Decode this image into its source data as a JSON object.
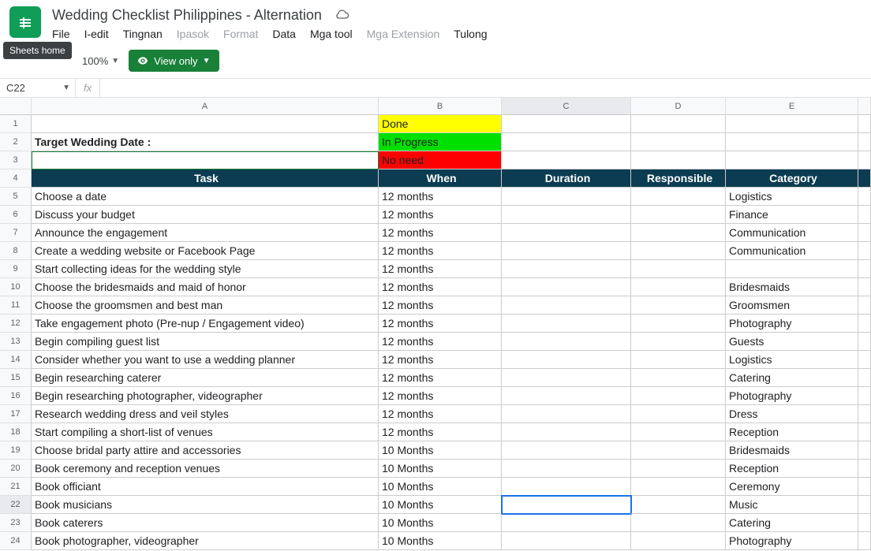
{
  "tooltip": "Sheets home",
  "doc_title": "Wedding Checklist Philippines - Alternation",
  "menus": {
    "file": "File",
    "edit": "I-edit",
    "view": "Tingnan",
    "insert": "Ipasok",
    "format": "Format",
    "data": "Data",
    "tools": "Mga tool",
    "extensions": "Mga Extension",
    "help": "Tulong"
  },
  "zoom": "100%",
  "view_only": "View only",
  "namebox": "C22",
  "cols": [
    "A",
    "B",
    "C",
    "D",
    "E"
  ],
  "status": {
    "done": "Done",
    "inprog": "In Progress",
    "noneed": "No need"
  },
  "target_label": "Target Wedding Date :",
  "headers": {
    "task": "Task",
    "when": "When",
    "duration": "Duration",
    "responsible": "Responsible",
    "category": "Category"
  },
  "rows": [
    {
      "n": 5,
      "task": "Choose a date",
      "when": "12 months",
      "cat": "Logistics"
    },
    {
      "n": 6,
      "task": "Discuss your budget",
      "when": "12 months",
      "cat": "Finance"
    },
    {
      "n": 7,
      "task": "Announce the engagement",
      "when": "12 months",
      "cat": "Communication"
    },
    {
      "n": 8,
      "task": "Create a wedding website or Facebook Page",
      "when": "12 months",
      "cat": "Communication"
    },
    {
      "n": 9,
      "task": "Start collecting ideas for the wedding style",
      "when": "12 months",
      "cat": ""
    },
    {
      "n": 10,
      "task": "Choose the bridesmaids and maid of honor",
      "when": "12 months",
      "cat": "Bridesmaids"
    },
    {
      "n": 11,
      "task": "Choose the groomsmen and best man",
      "when": "12 months",
      "cat": "Groomsmen"
    },
    {
      "n": 12,
      "task": "Take engagement photo (Pre-nup / Engagement video)",
      "when": "12 months",
      "cat": "Photography"
    },
    {
      "n": 13,
      "task": "Begin compiling guest list",
      "when": "12 months",
      "cat": "Guests"
    },
    {
      "n": 14,
      "task": "Consider whether you want to use a wedding planner",
      "when": "12 months",
      "cat": "Logistics"
    },
    {
      "n": 15,
      "task": "Begin researching caterer",
      "when": "12 months",
      "cat": "Catering"
    },
    {
      "n": 16,
      "task": "Begin researching photographer, videographer",
      "when": "12 months",
      "cat": "Photography"
    },
    {
      "n": 17,
      "task": "Research wedding dress and veil styles",
      "when": "12 months",
      "cat": "Dress"
    },
    {
      "n": 18,
      "task": "Start compiling a short-list of venues",
      "when": "12 months",
      "cat": "Reception"
    },
    {
      "n": 19,
      "task": "Choose bridal party attire and accessories",
      "when": "10 Months",
      "cat": "Bridesmaids"
    },
    {
      "n": 20,
      "task": "Book ceremony and reception venues",
      "when": "10 Months",
      "cat": "Reception"
    },
    {
      "n": 21,
      "task": "Book officiant",
      "when": "10 Months",
      "cat": "Ceremony"
    },
    {
      "n": 22,
      "task": "Book musicians",
      "when": "10 Months",
      "cat": "Music"
    },
    {
      "n": 23,
      "task": "Book caterers",
      "when": "10 Months",
      "cat": "Catering"
    },
    {
      "n": 24,
      "task": "Book photographer, videographer",
      "when": "10 Months",
      "cat": "Photography"
    }
  ]
}
